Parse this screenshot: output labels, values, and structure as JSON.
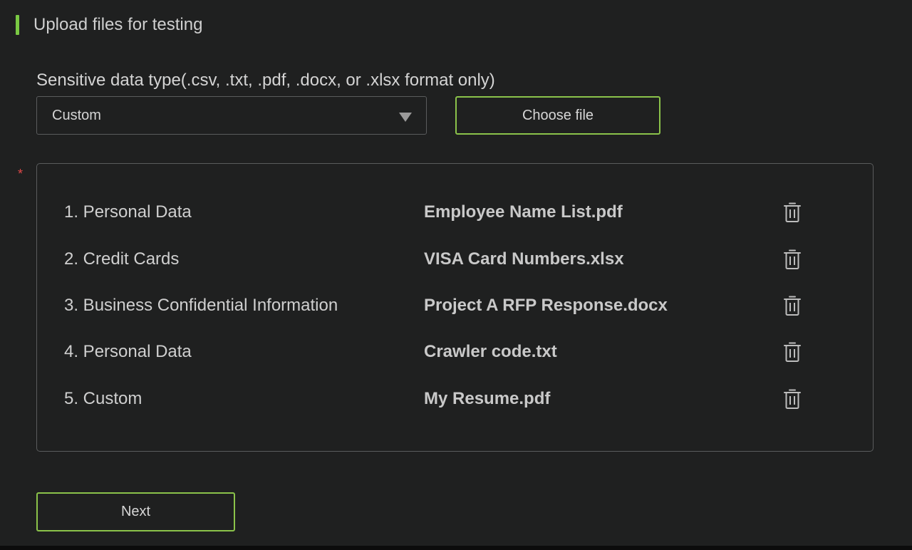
{
  "header": {
    "title": "Upload files for testing"
  },
  "form": {
    "type_label": "Sensitive data type(.csv, .txt, .pdf, .docx, or .xlsx format only)",
    "type_value": "Custom",
    "choose_file_label": "Choose file",
    "required_marker": "*"
  },
  "files": [
    {
      "type": "1. Personal Data",
      "name": "Employee Name List.pdf"
    },
    {
      "type": "2. Credit Cards",
      "name": "VISA Card Numbers.xlsx"
    },
    {
      "type": "3. Business Confidential Information",
      "name": "Project A RFP Response.docx"
    },
    {
      "type": "4. Personal Data",
      "name": "Crawler code.txt"
    },
    {
      "type": "5. Custom",
      "name": "My Resume.pdf"
    }
  ],
  "actions": {
    "next_label": "Next"
  },
  "colors": {
    "accent": "#8bc34a",
    "background": "#1f2020",
    "required": "#e04848"
  },
  "icons": {
    "delete": "trash-icon",
    "dropdown": "chevron-down-icon"
  }
}
